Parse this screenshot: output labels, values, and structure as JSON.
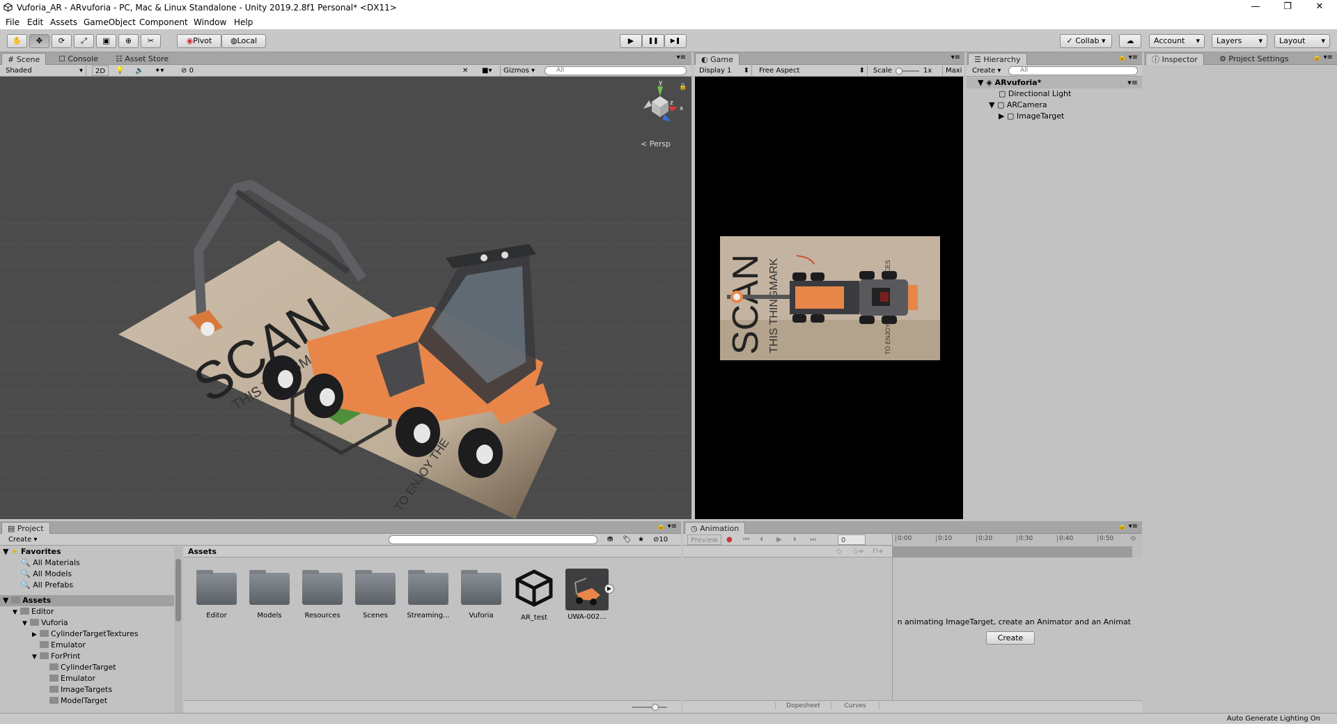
{
  "window": {
    "title": "Vuforia_AR - ARvuforia - PC, Mac & Linux Standalone - Unity 2019.2.8f1 Personal* <DX11>",
    "controls": {
      "minimize": "—",
      "maximize": "❐",
      "close": "✕"
    }
  },
  "menu": [
    "File",
    "Edit",
    "Assets",
    "GameObject",
    "Component",
    "Window",
    "Help"
  ],
  "toolbar": {
    "tools": [
      "hand",
      "move",
      "rotate",
      "scale",
      "rect",
      "transform",
      "custom"
    ],
    "pivot": "Pivot",
    "local": "Local",
    "play": "▶",
    "pause": "❚❚",
    "step": "▶❚",
    "collab": "Collab",
    "account": "Account",
    "layers": "Layers",
    "layout": "Layout"
  },
  "scene": {
    "tabs": [
      "Scene",
      "Console",
      "Asset Store"
    ],
    "shading": "Shaded",
    "mode2d": "2D",
    "hidden_count": "0",
    "gizmos": "Gizmos",
    "search_placeholder": "All",
    "persp": "Persp",
    "axis_y": "y",
    "axis_x": "x",
    "axis_z": "z",
    "poster_title": "SCAN",
    "poster_sub": "THIS THINGMARK",
    "poster_footer": "TO ENJOY THE"
  },
  "game": {
    "tab": "Game",
    "display": "Display 1",
    "aspect": "Free Aspect",
    "scale_label": "Scale",
    "scale_value": "1x",
    "maximize": "Maxi",
    "poster_title": "SCAN",
    "poster_sub": "THIS THINGMARK",
    "poster_side": "ERIENCES",
    "poster_footer": "TO ENJOY"
  },
  "hierarchy": {
    "tab": "Hierarchy",
    "create": "Create",
    "search_placeholder": "All",
    "scene_name": "ARvuforia*",
    "items": [
      "Directional Light",
      "ARCamera",
      "ImageTarget"
    ]
  },
  "inspector": {
    "tabs": [
      "Inspector",
      "Project Settings"
    ]
  },
  "project": {
    "tab": "Project",
    "create": "Create",
    "favorites_label": "Favorites",
    "favorites": [
      "All Materials",
      "All Models",
      "All Prefabs"
    ],
    "assets_label": "Assets",
    "tree": [
      {
        "label": "Editor",
        "depth": 1,
        "arrow": "▼"
      },
      {
        "label": "Vuforia",
        "depth": 2,
        "arrow": "▼"
      },
      {
        "label": "CylinderTargetTextures",
        "depth": 3,
        "arrow": "▶"
      },
      {
        "label": "Emulator",
        "depth": 3,
        "arrow": ""
      },
      {
        "label": "ForPrint",
        "depth": 3,
        "arrow": "▼"
      },
      {
        "label": "CylinderTarget",
        "depth": 4,
        "arrow": ""
      },
      {
        "label": "Emulator",
        "depth": 4,
        "arrow": ""
      },
      {
        "label": "ImageTargets",
        "depth": 4,
        "arrow": ""
      },
      {
        "label": "ModelTarget",
        "depth": 4,
        "arrow": ""
      }
    ],
    "breadcrumb": "Assets",
    "hidden_count": "10",
    "assets": [
      "Editor",
      "Models",
      "Resources",
      "Scenes",
      "Streaming...",
      "Vuforia",
      "AR_test",
      "UWA-002..."
    ]
  },
  "animation": {
    "tab": "Animation",
    "preview": "Preview",
    "frame": "0",
    "timeline": [
      "0:00",
      "0:10",
      "0:20",
      "0:30",
      "0:40",
      "0:50"
    ],
    "message": "n animating ImageTarget, create an Animator and an Animat",
    "create": "Create",
    "dopesheet": "Dopesheet",
    "curves": "Curves"
  },
  "status": {
    "lighting": "Auto Generate Lighting On"
  },
  "colors": {
    "accent_orange": "#e8864a",
    "dark_chassis": "#3a3b3e",
    "scene_bg": "#4a4a4a",
    "poster": "#c8b8a6"
  }
}
